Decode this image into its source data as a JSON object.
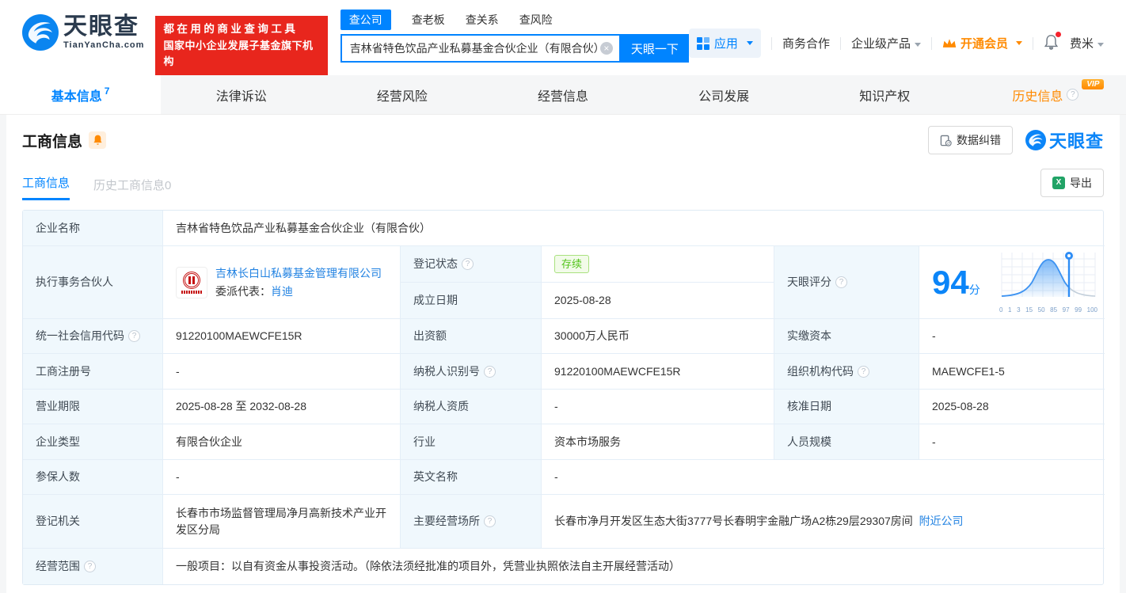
{
  "colors": {
    "accent": "#0084ff",
    "orange": "#ff8a00",
    "green": "#52c41a",
    "banner_red": "#e8261d",
    "link": "#2383e2"
  },
  "header": {
    "brand": {
      "name": "天眼查",
      "domain": "TianYanCha.com"
    },
    "slogan": {
      "line1": "都在用的商业查询工具",
      "line2": "国家中小企业发展子基金旗下机构"
    },
    "search": {
      "tabs": [
        {
          "label": "查公司"
        },
        {
          "label": "查老板"
        },
        {
          "label": "查关系"
        },
        {
          "label": "查风险"
        }
      ],
      "query": "吉林省特色饮品产业私募基金合伙企业（有限合伙）",
      "button": "天眼一下"
    },
    "nav": {
      "apps": "应用",
      "cooperation": "商务合作",
      "enterprise": "企业级产品",
      "vip": "开通会员",
      "user": "费米"
    }
  },
  "tabs": [
    {
      "label": "基本信息",
      "count": "7"
    },
    {
      "label": "法律诉讼"
    },
    {
      "label": "经营风险"
    },
    {
      "label": "经营信息"
    },
    {
      "label": "公司发展"
    },
    {
      "label": "知识产权"
    },
    {
      "label": "历史信息",
      "vip": "VIP"
    }
  ],
  "section": {
    "title": "工商信息",
    "correction": "数据纠错",
    "watermark": "天眼查",
    "subtabs": {
      "current": "工商信息",
      "history": "历史工商信息0"
    },
    "export": "导出"
  },
  "table": {
    "company_name": {
      "label": "企业名称",
      "value": "吉林省特色饮品产业私募基金合伙企业（有限合伙）"
    },
    "partner": {
      "label": "执行事务合伙人",
      "company": "吉林长白山私募基金管理有限公司",
      "rep_label": "委派代表：",
      "rep": "肖迪"
    },
    "reg_status": {
      "label": "登记状态",
      "value": "存续"
    },
    "est_date": {
      "label": "成立日期",
      "value": "2025-08-28"
    },
    "score": {
      "label": "天眼评分",
      "value": "94",
      "unit": "分",
      "ticks": [
        "0",
        "1",
        "3",
        "15",
        "50",
        "85",
        "97",
        "99",
        "100"
      ]
    },
    "credit_code": {
      "label": "统一社会信用代码",
      "value": "91220100MAEWCFE15R"
    },
    "capital": {
      "label": "出资额",
      "value": "30000万人民币"
    },
    "paid_capital": {
      "label": "实缴资本",
      "value": "-"
    },
    "reg_number": {
      "label": "工商注册号",
      "value": "-"
    },
    "taxpayer_id": {
      "label": "纳税人识别号",
      "value": "91220100MAEWCFE15R"
    },
    "org_code": {
      "label": "组织机构代码",
      "value": "MAEWCFE1-5"
    },
    "business_term": {
      "label": "营业期限",
      "value": "2025-08-28 至 2032-08-28"
    },
    "taxpayer_quality": {
      "label": "纳税人资质",
      "value": "-"
    },
    "approval_date": {
      "label": "核准日期",
      "value": "2025-08-28"
    },
    "company_type": {
      "label": "企业类型",
      "value": "有限合伙企业"
    },
    "industry": {
      "label": "行业",
      "value": "资本市场服务"
    },
    "staff_size": {
      "label": "人员规模",
      "value": "-"
    },
    "insured_count": {
      "label": "参保人数",
      "value": "-"
    },
    "english_name": {
      "label": "英文名称",
      "value": "-"
    },
    "reg_authority": {
      "label": "登记机关",
      "value": "长春市市场监督管理局净月高新技术产业开发区分局"
    },
    "business_place": {
      "label": "主要经营场所",
      "value": "长春市净月开发区生态大街3777号长春明宇金融广场A2栋29层29307房间",
      "nearby": "附近公司"
    },
    "business_scope": {
      "label": "经营范围",
      "value": "一般项目：以自有资金从事投资活动。（除依法须经批准的项目外，凭营业执照依法自主开展经营活动）"
    }
  }
}
